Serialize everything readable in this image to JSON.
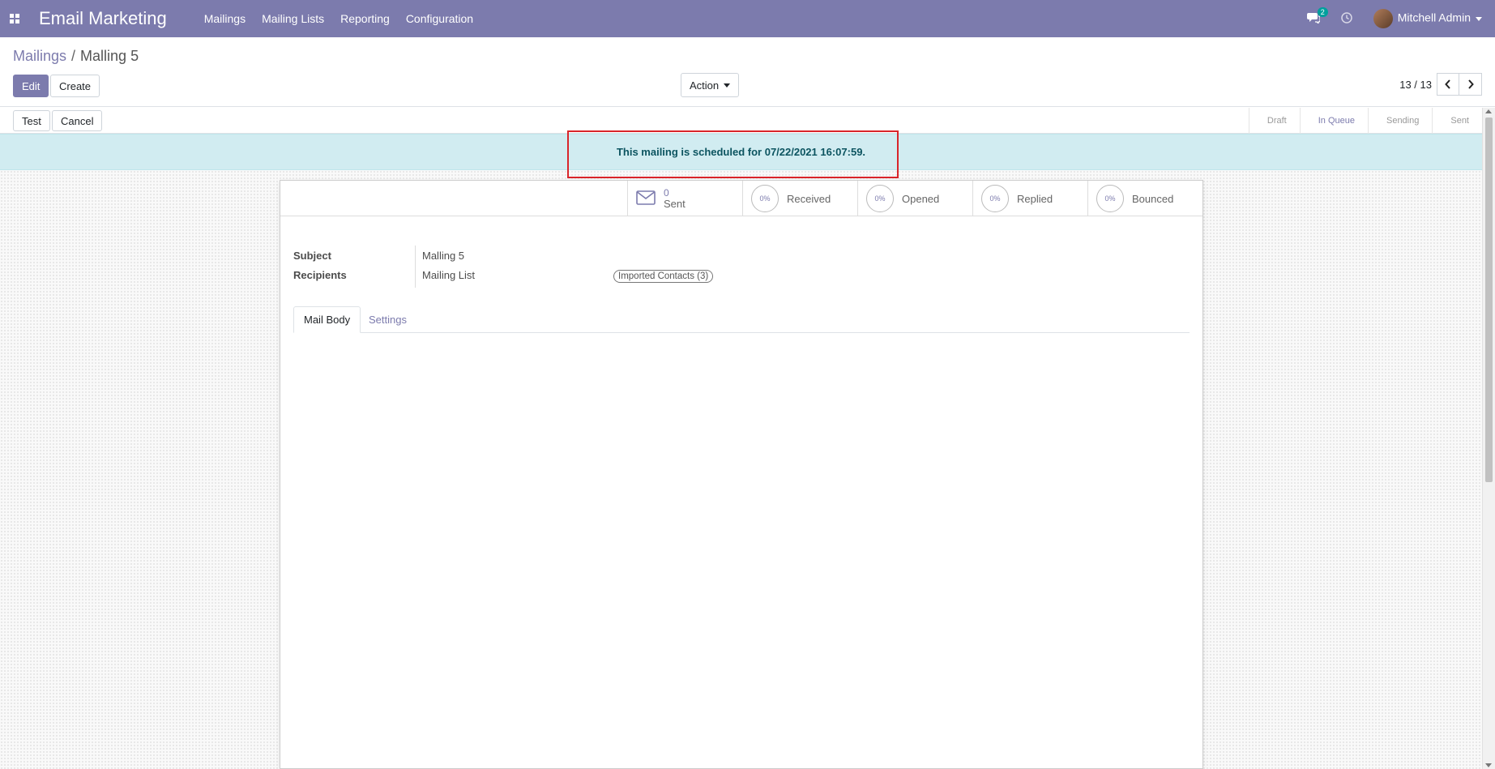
{
  "navbar": {
    "app_title": "Email Marketing",
    "menus": [
      "Mailings",
      "Mailing Lists",
      "Reporting",
      "Configuration"
    ],
    "chat_count": "2",
    "user_name": "Mitchell Admin",
    "icons": [
      "apps-grid-icon",
      "chat-icon",
      "clock-icon",
      "avatar"
    ],
    "color": "#7c7bad"
  },
  "breadcrumb": {
    "parent": "Mailings",
    "separator": "/",
    "current": "Malling 5"
  },
  "buttons": {
    "edit": "Edit",
    "create": "Create",
    "action": "Action",
    "test": "Test",
    "cancel": "Cancel"
  },
  "pager": {
    "value": "13 / 13"
  },
  "statusbar": {
    "steps": [
      "Draft",
      "In Queue",
      "Sending",
      "Sent"
    ],
    "current": "In Queue"
  },
  "alert": {
    "text": "This mailing is scheduled for 07/22/2021 16:07:59.",
    "color": "#d1ecf1"
  },
  "stats": {
    "sent_count": "0",
    "sent_label": "Sent",
    "received_pct": "0%",
    "received_label": "Received",
    "opened_pct": "0%",
    "opened_label": "Opened",
    "replied_pct": "0%",
    "replied_label": "Replied",
    "bounced_pct": "0%",
    "bounced_label": "Bounced"
  },
  "form": {
    "subject_label": "Subject",
    "subject_value": "Malling 5",
    "recipients_label": "Recipients",
    "recipients_value": "Mailing List",
    "mailing_list_tag": "Imported Contacts (3)"
  },
  "tabs": {
    "mail_body": "Mail Body",
    "settings": "Settings",
    "active": "Mail Body"
  }
}
